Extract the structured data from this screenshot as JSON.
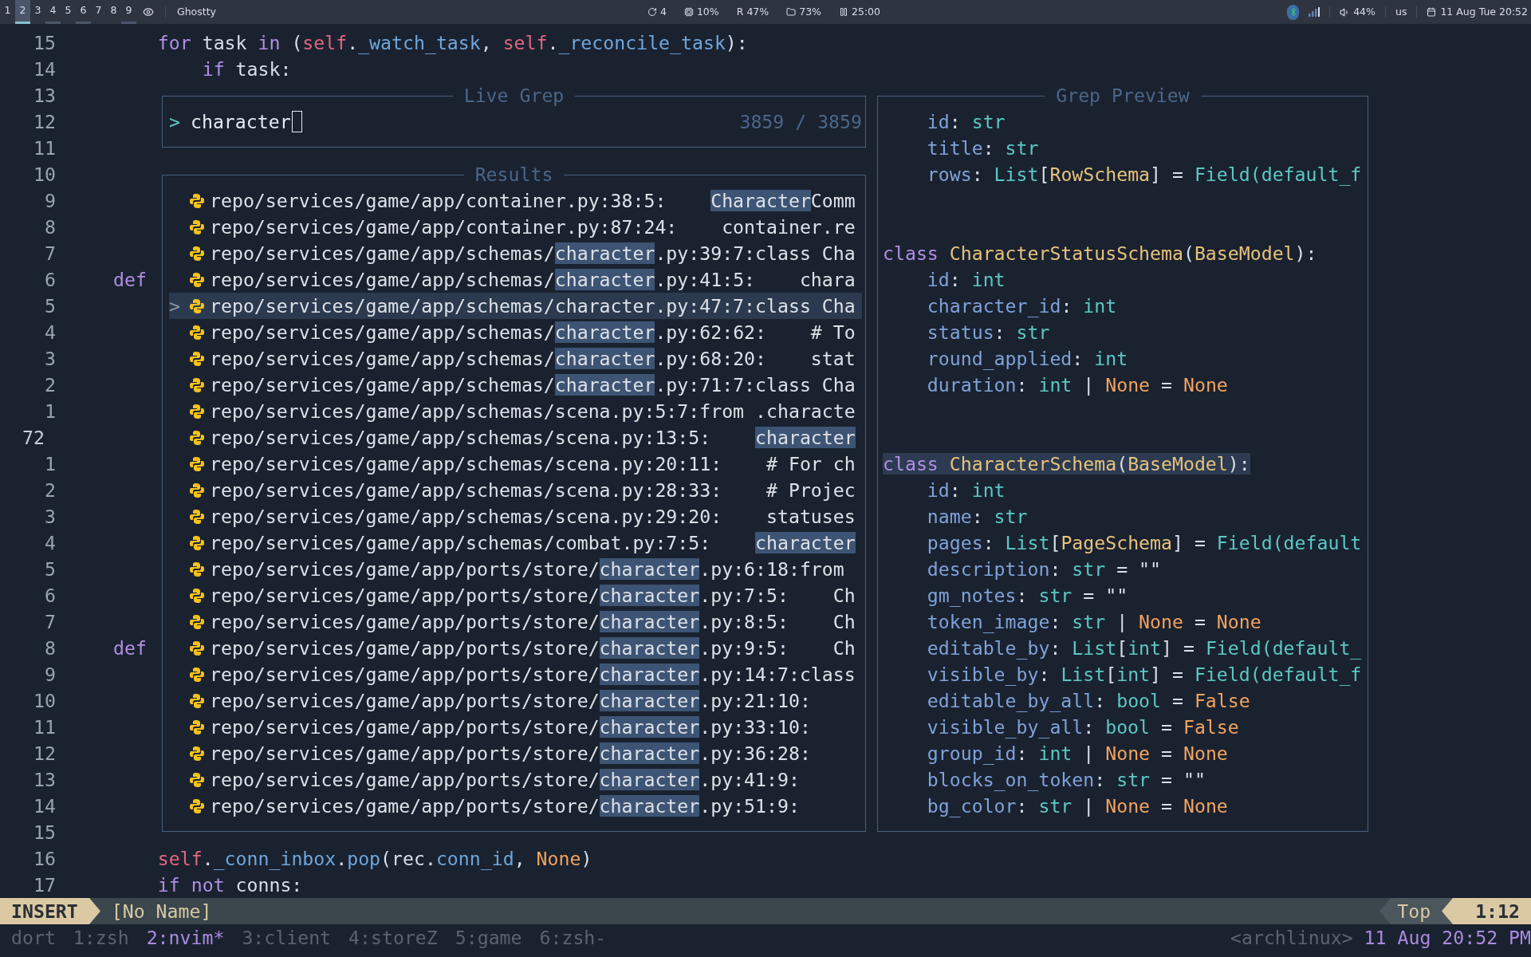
{
  "topbar": {
    "workspaces": [
      {
        "label": "1",
        "selected": false,
        "occupied": false
      },
      {
        "label": "2",
        "selected": true,
        "occupied": true
      },
      {
        "label": "3",
        "selected": false,
        "occupied": false
      },
      {
        "label": "4",
        "selected": false,
        "occupied": true
      },
      {
        "label": "5",
        "selected": false,
        "occupied": false
      },
      {
        "label": "6",
        "selected": false,
        "occupied": true
      },
      {
        "label": "7",
        "selected": false,
        "occupied": false
      },
      {
        "label": "8",
        "selected": false,
        "occupied": false
      },
      {
        "label": "9",
        "selected": false,
        "occupied": true
      }
    ],
    "window_title": "Ghostty",
    "stats": [
      {
        "kind": "updates",
        "text": "4"
      },
      {
        "kind": "cpu",
        "text": "10%"
      },
      {
        "kind": "memory",
        "label": "R",
        "text": "47%"
      },
      {
        "kind": "disk",
        "text": "73%"
      },
      {
        "kind": "timer",
        "text": "25:00"
      }
    ],
    "tray": {
      "volume": "44%",
      "layout": "us",
      "clock": "11 Aug Tue 20:52"
    }
  },
  "editor": {
    "lines": [
      {
        "number": "15",
        "current": false,
        "tokens": [
          {
            "text": "    for",
            "kind": "keyword"
          },
          {
            "text": " task ",
            "kind": "plain"
          },
          {
            "text": "in",
            "kind": "keyword"
          },
          {
            "text": " (",
            "kind": "plain"
          },
          {
            "text": "self",
            "kind": "self"
          },
          {
            "text": ".",
            "kind": "plain"
          },
          {
            "text": "_watch_task",
            "kind": "attribute"
          },
          {
            "text": ", ",
            "kind": "plain"
          },
          {
            "text": "self",
            "kind": "self"
          },
          {
            "text": ".",
            "kind": "plain"
          },
          {
            "text": "_reconcile_task",
            "kind": "attribute"
          },
          {
            "text": "):",
            "kind": "plain"
          }
        ]
      },
      {
        "number": "14",
        "current": false,
        "tokens": [
          {
            "text": "        if",
            "kind": "keyword"
          },
          {
            "text": " task:",
            "kind": "plain"
          }
        ]
      },
      {
        "number": "13",
        "current": false
      },
      {
        "number": "12",
        "current": false
      },
      {
        "number": "11",
        "current": false
      },
      {
        "number": "10",
        "current": false
      },
      {
        "number": "9",
        "current": false
      },
      {
        "number": "8",
        "current": false
      },
      {
        "number": "7",
        "current": false
      },
      {
        "number": "6",
        "current": false,
        "tokens": [
          {
            "text": "def",
            "kind": "keyword"
          }
        ]
      },
      {
        "number": "5",
        "current": false
      },
      {
        "number": "4",
        "current": false
      },
      {
        "number": "3",
        "current": false
      },
      {
        "number": "2",
        "current": false
      },
      {
        "number": "1",
        "current": false
      },
      {
        "number": "72",
        "current": true
      },
      {
        "number": "1",
        "current": false
      },
      {
        "number": "2",
        "current": false
      },
      {
        "number": "3",
        "current": false
      },
      {
        "number": "4",
        "current": false
      },
      {
        "number": "5",
        "current": false
      },
      {
        "number": "6",
        "current": false
      },
      {
        "number": "7",
        "current": false
      },
      {
        "number": "8",
        "current": false,
        "tokens": [
          {
            "text": "def",
            "kind": "keyword"
          }
        ]
      },
      {
        "number": "9",
        "current": false
      },
      {
        "number": "10",
        "current": false
      },
      {
        "number": "11",
        "current": false
      },
      {
        "number": "12",
        "current": false
      },
      {
        "number": "13",
        "current": false
      },
      {
        "number": "14",
        "current": false
      },
      {
        "number": "15",
        "current": false
      },
      {
        "number": "16",
        "current": false,
        "tokens": [
          {
            "text": "    self",
            "kind": "self"
          },
          {
            "text": ".",
            "kind": "plain"
          },
          {
            "text": "_conn_inbox",
            "kind": "attribute"
          },
          {
            "text": ".",
            "kind": "plain"
          },
          {
            "text": "pop",
            "kind": "attribute"
          },
          {
            "text": "(rec.",
            "kind": "plain"
          },
          {
            "text": "conn_id",
            "kind": "attribute"
          },
          {
            "text": ", ",
            "kind": "plain"
          },
          {
            "text": "None",
            "kind": "constant"
          },
          {
            "text": ")",
            "kind": "plain"
          }
        ]
      },
      {
        "number": "17",
        "current": false,
        "tokens": [
          {
            "text": "    if",
            "kind": "keyword"
          },
          {
            "text": " not",
            "kind": "keyword"
          },
          {
            "text": " conns:",
            "kind": "plain"
          }
        ]
      }
    ]
  },
  "live_grep": {
    "title": "Live Grep",
    "prompt": ">",
    "query": "character",
    "count": "3859 / 3859"
  },
  "results": {
    "title": "Results",
    "selector": ">",
    "items": [
      {
        "selected": false,
        "segments": [
          {
            "text": "repo/services/game/app/container.py:38:5:    ",
            "highlight": false
          },
          {
            "text": "Character",
            "highlight": true
          },
          {
            "text": "Comm",
            "highlight": false
          }
        ]
      },
      {
        "selected": false,
        "segments": [
          {
            "text": "repo/services/game/app/container.py:87:24:    container.re",
            "highlight": false
          }
        ]
      },
      {
        "selected": false,
        "segments": [
          {
            "text": "repo/services/game/app/schemas/",
            "highlight": false
          },
          {
            "text": "character",
            "highlight": true
          },
          {
            "text": ".py:39:7:class Cha",
            "highlight": false
          }
        ]
      },
      {
        "selected": false,
        "segments": [
          {
            "text": "repo/services/game/app/schemas/",
            "highlight": false
          },
          {
            "text": "character",
            "highlight": true
          },
          {
            "text": ".py:41:5:    chara",
            "highlight": false
          }
        ]
      },
      {
        "selected": true,
        "segments": [
          {
            "text": "repo/services/game/app/schemas/character.py:47:7:class Cha",
            "highlight": false
          }
        ]
      },
      {
        "selected": false,
        "segments": [
          {
            "text": "repo/services/game/app/schemas/",
            "highlight": false
          },
          {
            "text": "character",
            "highlight": true
          },
          {
            "text": ".py:62:62:    # To",
            "highlight": false
          }
        ]
      },
      {
        "selected": false,
        "segments": [
          {
            "text": "repo/services/game/app/schemas/",
            "highlight": false
          },
          {
            "text": "character",
            "highlight": true
          },
          {
            "text": ".py:68:20:    stat",
            "highlight": false
          }
        ]
      },
      {
        "selected": false,
        "segments": [
          {
            "text": "repo/services/game/app/schemas/",
            "highlight": false
          },
          {
            "text": "character",
            "highlight": true
          },
          {
            "text": ".py:71:7:class Cha",
            "highlight": false
          }
        ]
      },
      {
        "selected": false,
        "segments": [
          {
            "text": "repo/services/game/app/schemas/scena.py:5:7:from .characte",
            "highlight": false
          }
        ]
      },
      {
        "selected": false,
        "segments": [
          {
            "text": "repo/services/game/app/schemas/scena.py:13:5:    ",
            "highlight": false
          },
          {
            "text": "character",
            "highlight": true
          }
        ]
      },
      {
        "selected": false,
        "segments": [
          {
            "text": "repo/services/game/app/schemas/scena.py:20:11:    # For ch",
            "highlight": false
          }
        ]
      },
      {
        "selected": false,
        "segments": [
          {
            "text": "repo/services/game/app/schemas/scena.py:28:33:    # Projec",
            "highlight": false
          }
        ]
      },
      {
        "selected": false,
        "segments": [
          {
            "text": "repo/services/game/app/schemas/scena.py:29:20:    statuses",
            "highlight": false
          }
        ]
      },
      {
        "selected": false,
        "segments": [
          {
            "text": "repo/services/game/app/schemas/combat.py:7:5:    ",
            "highlight": false
          },
          {
            "text": "character",
            "highlight": true
          }
        ]
      },
      {
        "selected": false,
        "segments": [
          {
            "text": "repo/services/game/app/ports/store/",
            "highlight": false
          },
          {
            "text": "character",
            "highlight": true
          },
          {
            "text": ".py:6:18:from",
            "highlight": false
          }
        ]
      },
      {
        "selected": false,
        "segments": [
          {
            "text": "repo/services/game/app/ports/store/",
            "highlight": false
          },
          {
            "text": "character",
            "highlight": true
          },
          {
            "text": ".py:7:5:    Ch",
            "highlight": false
          }
        ]
      },
      {
        "selected": false,
        "segments": [
          {
            "text": "repo/services/game/app/ports/store/",
            "highlight": false
          },
          {
            "text": "character",
            "highlight": true
          },
          {
            "text": ".py:8:5:    Ch",
            "highlight": false
          }
        ]
      },
      {
        "selected": false,
        "segments": [
          {
            "text": "repo/services/game/app/ports/store/",
            "highlight": false
          },
          {
            "text": "character",
            "highlight": true
          },
          {
            "text": ".py:9:5:    Ch",
            "highlight": false
          }
        ]
      },
      {
        "selected": false,
        "segments": [
          {
            "text": "repo/services/game/app/ports/store/",
            "highlight": false
          },
          {
            "text": "character",
            "highlight": true
          },
          {
            "text": ".py:14:7:class",
            "highlight": false
          }
        ]
      },
      {
        "selected": false,
        "segments": [
          {
            "text": "repo/services/game/app/ports/store/",
            "highlight": false
          },
          {
            "text": "character",
            "highlight": true
          },
          {
            "text": ".py:21:10:",
            "highlight": false
          }
        ]
      },
      {
        "selected": false,
        "segments": [
          {
            "text": "repo/services/game/app/ports/store/",
            "highlight": false
          },
          {
            "text": "character",
            "highlight": true
          },
          {
            "text": ".py:33:10:",
            "highlight": false
          }
        ]
      },
      {
        "selected": false,
        "segments": [
          {
            "text": "repo/services/game/app/ports/store/",
            "highlight": false
          },
          {
            "text": "character",
            "highlight": true
          },
          {
            "text": ".py:36:28:",
            "highlight": false
          }
        ]
      },
      {
        "selected": false,
        "segments": [
          {
            "text": "repo/services/game/app/ports/store/",
            "highlight": false
          },
          {
            "text": "character",
            "highlight": true
          },
          {
            "text": ".py:41:9:",
            "highlight": false
          }
        ]
      },
      {
        "selected": false,
        "segments": [
          {
            "text": "repo/services/game/app/ports/store/",
            "highlight": false
          },
          {
            "text": "character",
            "highlight": true
          },
          {
            "text": ".py:51:9:",
            "highlight": false
          }
        ]
      }
    ]
  },
  "preview": {
    "title": "Grep Preview",
    "lines": [
      {
        "kind": "code",
        "highlighted": false,
        "tokens": [
          {
            "text": "    id",
            "kind": "field"
          },
          {
            "text": ": ",
            "kind": "plain"
          },
          {
            "text": "str",
            "kind": "type"
          }
        ]
      },
      {
        "kind": "code",
        "highlighted": false,
        "tokens": [
          {
            "text": "    title",
            "kind": "field"
          },
          {
            "text": ": ",
            "kind": "plain"
          },
          {
            "text": "str",
            "kind": "type"
          }
        ]
      },
      {
        "kind": "code",
        "highlighted": false,
        "tokens": [
          {
            "text": "    rows",
            "kind": "field"
          },
          {
            "text": ": ",
            "kind": "plain"
          },
          {
            "text": "List",
            "kind": "type"
          },
          {
            "text": "[",
            "kind": "plain"
          },
          {
            "text": "RowSchema",
            "kind": "classname"
          },
          {
            "text": "] = ",
            "kind": "plain"
          },
          {
            "text": "Field(default_f",
            "kind": "type"
          }
        ]
      },
      {
        "kind": "blank"
      },
      {
        "kind": "blank"
      },
      {
        "kind": "code",
        "highlighted": false,
        "tokens": [
          {
            "text": "class ",
            "kind": "keyword"
          },
          {
            "text": "CharacterStatusSchema",
            "kind": "classname"
          },
          {
            "text": "(",
            "kind": "plain"
          },
          {
            "text": "BaseModel",
            "kind": "classname"
          },
          {
            "text": "):",
            "kind": "plain"
          }
        ]
      },
      {
        "kind": "code",
        "highlighted": false,
        "tokens": [
          {
            "text": "    id",
            "kind": "field"
          },
          {
            "text": ": ",
            "kind": "plain"
          },
          {
            "text": "int",
            "kind": "type"
          }
        ]
      },
      {
        "kind": "code",
        "highlighted": false,
        "tokens": [
          {
            "text": "    character_id",
            "kind": "field"
          },
          {
            "text": ": ",
            "kind": "plain"
          },
          {
            "text": "int",
            "kind": "type"
          }
        ]
      },
      {
        "kind": "code",
        "highlighted": false,
        "tokens": [
          {
            "text": "    status",
            "kind": "field"
          },
          {
            "text": ": ",
            "kind": "plain"
          },
          {
            "text": "str",
            "kind": "type"
          }
        ]
      },
      {
        "kind": "code",
        "highlighted": false,
        "tokens": [
          {
            "text": "    round_applied",
            "kind": "field"
          },
          {
            "text": ": ",
            "kind": "plain"
          },
          {
            "text": "int",
            "kind": "type"
          }
        ]
      },
      {
        "kind": "code",
        "highlighted": false,
        "tokens": [
          {
            "text": "    duration",
            "kind": "field"
          },
          {
            "text": ": ",
            "kind": "plain"
          },
          {
            "text": "int",
            "kind": "type"
          },
          {
            "text": " | ",
            "kind": "plain"
          },
          {
            "text": "None",
            "kind": "constant"
          },
          {
            "text": " = ",
            "kind": "plain"
          },
          {
            "text": "None",
            "kind": "constant"
          }
        ]
      },
      {
        "kind": "blank"
      },
      {
        "kind": "blank"
      },
      {
        "kind": "code",
        "highlighted": true,
        "tokens": [
          {
            "text": "class ",
            "kind": "keyword"
          },
          {
            "text": "CharacterSchema",
            "kind": "classname"
          },
          {
            "text": "(",
            "kind": "plain"
          },
          {
            "text": "BaseModel",
            "kind": "classname"
          },
          {
            "text": "):",
            "kind": "plain"
          }
        ]
      },
      {
        "kind": "code",
        "highlighted": false,
        "tokens": [
          {
            "text": "    id",
            "kind": "field"
          },
          {
            "text": ": ",
            "kind": "plain"
          },
          {
            "text": "int",
            "kind": "type"
          }
        ]
      },
      {
        "kind": "code",
        "highlighted": false,
        "tokens": [
          {
            "text": "    name",
            "kind": "field"
          },
          {
            "text": ": ",
            "kind": "plain"
          },
          {
            "text": "str",
            "kind": "type"
          }
        ]
      },
      {
        "kind": "code",
        "highlighted": false,
        "tokens": [
          {
            "text": "    pages",
            "kind": "field"
          },
          {
            "text": ": ",
            "kind": "plain"
          },
          {
            "text": "List",
            "kind": "type"
          },
          {
            "text": "[",
            "kind": "plain"
          },
          {
            "text": "PageSchema",
            "kind": "classname"
          },
          {
            "text": "] = ",
            "kind": "plain"
          },
          {
            "text": "Field(default",
            "kind": "type"
          }
        ]
      },
      {
        "kind": "code",
        "highlighted": false,
        "tokens": [
          {
            "text": "    description",
            "kind": "field"
          },
          {
            "text": ": ",
            "kind": "plain"
          },
          {
            "text": "str",
            "kind": "type"
          },
          {
            "text": " = \"\"",
            "kind": "plain"
          }
        ]
      },
      {
        "kind": "code",
        "highlighted": false,
        "tokens": [
          {
            "text": "    gm_notes",
            "kind": "field"
          },
          {
            "text": ": ",
            "kind": "plain"
          },
          {
            "text": "str",
            "kind": "type"
          },
          {
            "text": " = \"\"",
            "kind": "plain"
          }
        ]
      },
      {
        "kind": "code",
        "highlighted": false,
        "tokens": [
          {
            "text": "    token_image",
            "kind": "field"
          },
          {
            "text": ": ",
            "kind": "plain"
          },
          {
            "text": "str",
            "kind": "type"
          },
          {
            "text": " | ",
            "kind": "plain"
          },
          {
            "text": "None",
            "kind": "constant"
          },
          {
            "text": " = ",
            "kind": "plain"
          },
          {
            "text": "None",
            "kind": "constant"
          }
        ]
      },
      {
        "kind": "code",
        "highlighted": false,
        "tokens": [
          {
            "text": "    editable_by",
            "kind": "field"
          },
          {
            "text": ": ",
            "kind": "plain"
          },
          {
            "text": "List",
            "kind": "type"
          },
          {
            "text": "[",
            "kind": "plain"
          },
          {
            "text": "int",
            "kind": "type"
          },
          {
            "text": "] = ",
            "kind": "plain"
          },
          {
            "text": "Field(default_",
            "kind": "type"
          }
        ]
      },
      {
        "kind": "code",
        "highlighted": false,
        "tokens": [
          {
            "text": "    visible_by",
            "kind": "field"
          },
          {
            "text": ": ",
            "kind": "plain"
          },
          {
            "text": "List",
            "kind": "type"
          },
          {
            "text": "[",
            "kind": "plain"
          },
          {
            "text": "int",
            "kind": "type"
          },
          {
            "text": "] = ",
            "kind": "plain"
          },
          {
            "text": "Field(default_f",
            "kind": "type"
          }
        ]
      },
      {
        "kind": "code",
        "highlighted": false,
        "tokens": [
          {
            "text": "    editable_by_all",
            "kind": "field"
          },
          {
            "text": ": ",
            "kind": "plain"
          },
          {
            "text": "bool",
            "kind": "type"
          },
          {
            "text": " = ",
            "kind": "plain"
          },
          {
            "text": "False",
            "kind": "constant"
          }
        ]
      },
      {
        "kind": "code",
        "highlighted": false,
        "tokens": [
          {
            "text": "    visible_by_all",
            "kind": "field"
          },
          {
            "text": ": ",
            "kind": "plain"
          },
          {
            "text": "bool",
            "kind": "type"
          },
          {
            "text": " = ",
            "kind": "plain"
          },
          {
            "text": "False",
            "kind": "constant"
          }
        ]
      },
      {
        "kind": "code",
        "highlighted": false,
        "tokens": [
          {
            "text": "    group_id",
            "kind": "field"
          },
          {
            "text": ": ",
            "kind": "plain"
          },
          {
            "text": "int",
            "kind": "type"
          },
          {
            "text": " | ",
            "kind": "plain"
          },
          {
            "text": "None",
            "kind": "constant"
          },
          {
            "text": " = ",
            "kind": "plain"
          },
          {
            "text": "None",
            "kind": "constant"
          }
        ]
      },
      {
        "kind": "code",
        "highlighted": false,
        "tokens": [
          {
            "text": "    blocks_on_token",
            "kind": "field"
          },
          {
            "text": ": ",
            "kind": "plain"
          },
          {
            "text": "str",
            "kind": "type"
          },
          {
            "text": " = \"\"",
            "kind": "plain"
          }
        ]
      },
      {
        "kind": "code",
        "highlighted": false,
        "tokens": [
          {
            "text": "    bg_color",
            "kind": "field"
          },
          {
            "text": ": ",
            "kind": "plain"
          },
          {
            "text": "str",
            "kind": "type"
          },
          {
            "text": " | ",
            "kind": "plain"
          },
          {
            "text": "None",
            "kind": "constant"
          },
          {
            "text": " = ",
            "kind": "plain"
          },
          {
            "text": "None",
            "kind": "constant"
          }
        ]
      }
    ]
  },
  "statusline": {
    "mode": "INSERT",
    "file": "[No Name]",
    "position": "Top",
    "cursor": "1:12"
  },
  "tmux": {
    "session": "dort",
    "windows": [
      {
        "label": "1:zsh",
        "selected": false
      },
      {
        "label": "2:nvim*",
        "selected": true
      },
      {
        "label": "3:client",
        "selected": false
      },
      {
        "label": "4:storeZ",
        "selected": false
      },
      {
        "label": "5:game",
        "selected": false
      },
      {
        "label": "6:zsh-",
        "selected": false
      }
    ],
    "host": "<archlinux>",
    "clock": "11 Aug 20:52 PM"
  }
}
